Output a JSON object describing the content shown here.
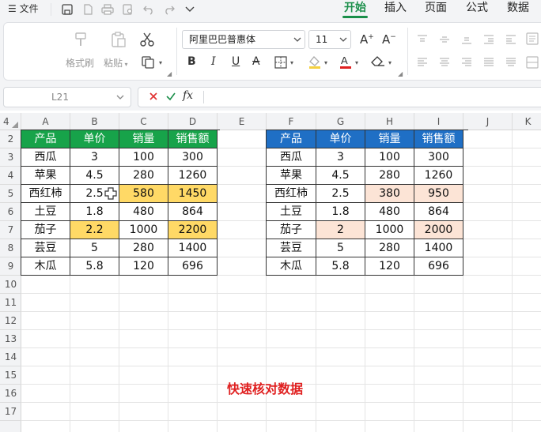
{
  "menubar": {
    "file_label": "文件",
    "tabs": [
      "开始",
      "插入",
      "页面",
      "公式",
      "数据"
    ],
    "active_tab": "开始"
  },
  "ribbon": {
    "format_painter": "格式刷",
    "paste": "粘贴",
    "font_name": "阿里巴巴普惠体",
    "font_size": "11"
  },
  "formula_bar": {
    "name_box": "L21",
    "fx": "fx",
    "value": ""
  },
  "grid": {
    "columns": [
      "A",
      "B",
      "C",
      "D",
      "E",
      "F",
      "G",
      "H",
      "I",
      "J",
      "K"
    ],
    "rows": [
      "2",
      "3",
      "4",
      "5",
      "6",
      "7",
      "8",
      "9",
      "10",
      "11",
      "12",
      "13",
      "14",
      "15",
      "16",
      "17"
    ],
    "top_row_partial": "4"
  },
  "table_left": {
    "header": [
      "产品",
      "单价",
      "销量",
      "销售额"
    ],
    "rows": [
      [
        "西瓜",
        "3",
        "100",
        "300"
      ],
      [
        "苹果",
        "4.5",
        "280",
        "1260"
      ],
      [
        "西红柿",
        "2.5",
        "580",
        "1450"
      ],
      [
        "土豆",
        "1.8",
        "480",
        "864"
      ],
      [
        "茄子",
        "2.2",
        "1000",
        "2200"
      ],
      [
        "芸豆",
        "5",
        "280",
        "1400"
      ],
      [
        "木瓜",
        "5.8",
        "120",
        "696"
      ]
    ],
    "header_color": "#17a34a",
    "highlight_color": "#ffd966"
  },
  "table_right": {
    "header": [
      "产品",
      "单价",
      "销量",
      "销售额"
    ],
    "rows": [
      [
        "西瓜",
        "3",
        "100",
        "300"
      ],
      [
        "苹果",
        "4.5",
        "280",
        "1260"
      ],
      [
        "西红柿",
        "2.5",
        "380",
        "950"
      ],
      [
        "土豆",
        "1.8",
        "480",
        "864"
      ],
      [
        "茄子",
        "2",
        "1000",
        "2000"
      ],
      [
        "芸豆",
        "5",
        "280",
        "1400"
      ],
      [
        "木瓜",
        "5.8",
        "120",
        "696"
      ]
    ],
    "header_color": "#1f6fc5",
    "highlight_color": "#fce4d6"
  },
  "caption": "快速核对数据"
}
